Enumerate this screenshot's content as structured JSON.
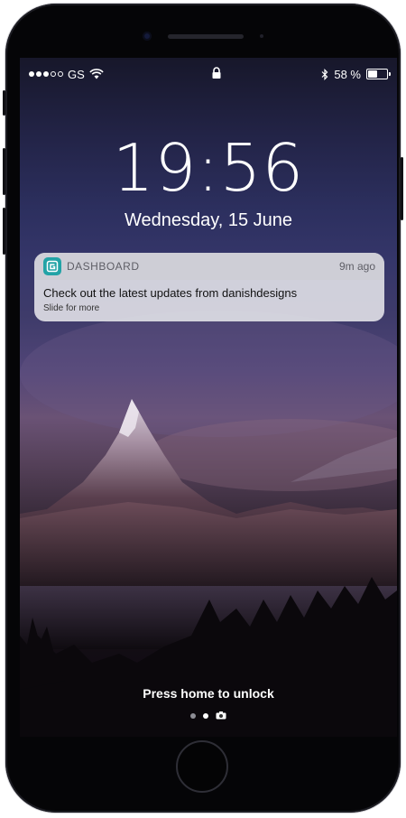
{
  "status_bar": {
    "signal_filled": 3,
    "signal_total": 5,
    "carrier": "GS",
    "wifi_icon": "wifi-icon",
    "lock_icon": "lock-icon",
    "bluetooth_icon": "bluetooth-icon",
    "battery_text": "58 %",
    "battery_level": 0.58
  },
  "lockscreen": {
    "time": "19:56",
    "date": "Wednesday, 15 June",
    "unlock_hint": "Press home to unlock"
  },
  "notification": {
    "app_icon": "dashboard-app-icon",
    "app_icon_color": "#22a3a6",
    "app_name": "DASHBOARD",
    "time_ago": "9m ago",
    "message": "Check out the latest updates from danishdesigns",
    "subtext": "Slide for more"
  },
  "pager": {
    "pages": 2,
    "active_page": 1,
    "camera_icon": "camera-icon"
  }
}
